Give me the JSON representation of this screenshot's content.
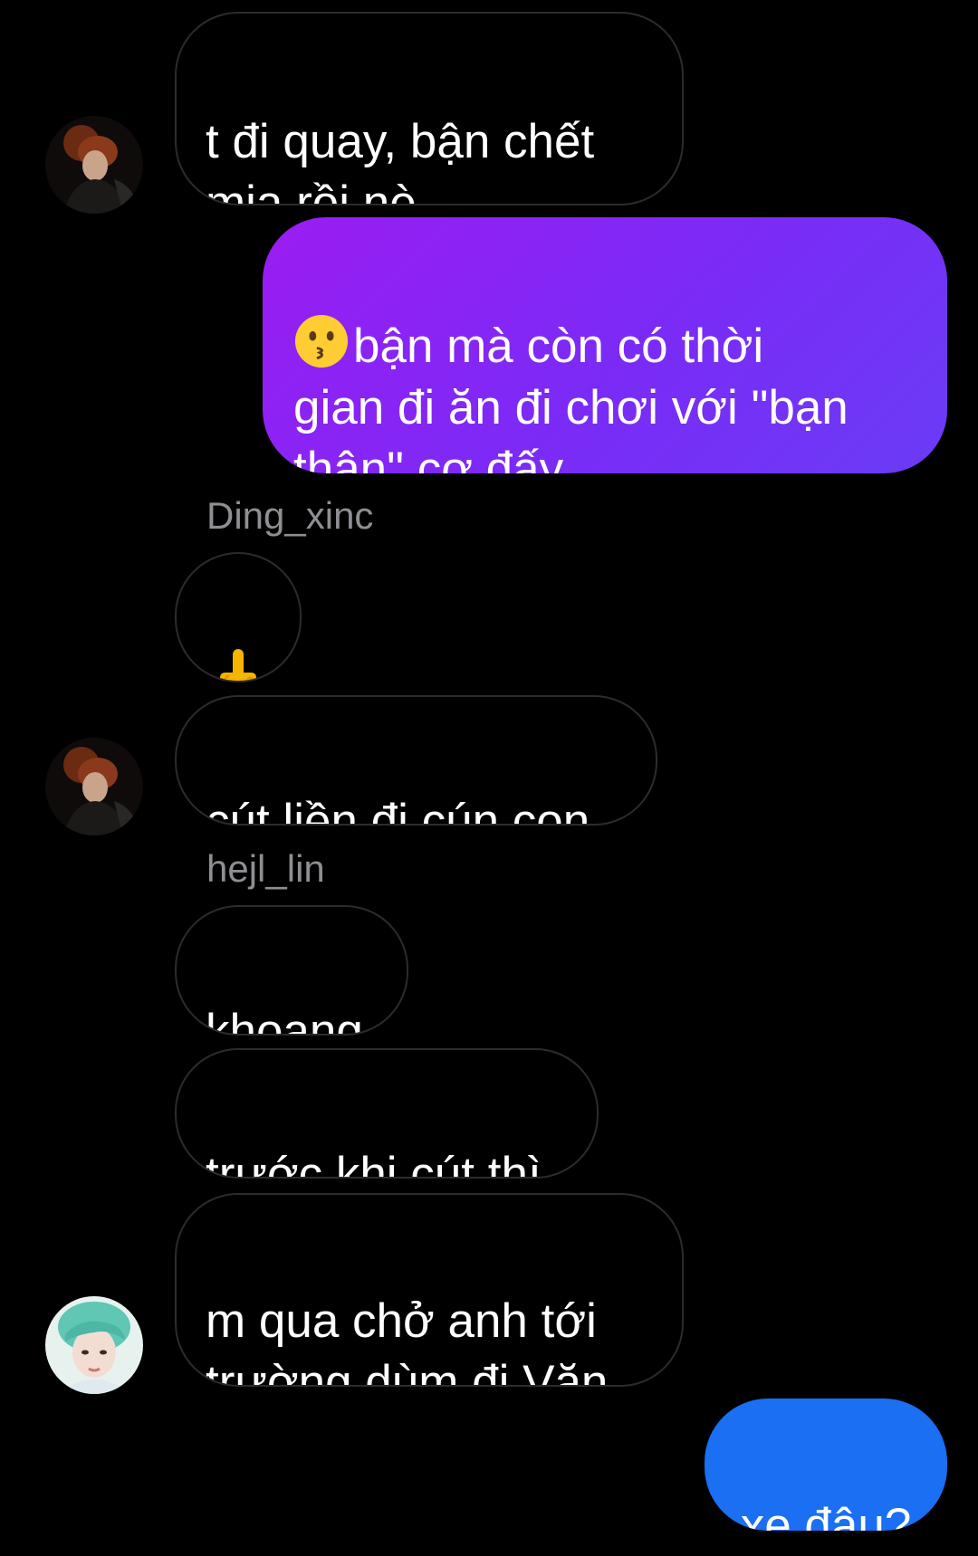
{
  "conversation": {
    "messages": [
      {
        "text": "t đi quay, bận chết\nmịa rồi nè"
      },
      {
        "emoji": "kissing-face-emoji",
        "text": "bận mà còn có thời\ngian đi ăn đi chơi với \"bạn\nthân\" cơ đấy"
      },
      {
        "sender": "Ding_xinc"
      },
      {
        "emoji": "middle-finger-emoji"
      },
      {
        "text": "cút liền đi cún con"
      },
      {
        "sender": "hejl_lin"
      },
      {
        "text": "khoang"
      },
      {
        "text": "trước khi cút thì"
      },
      {
        "text": "m qua chở anh tới\ntrường dùm đi Văn"
      },
      {
        "text": "xe đâu?"
      }
    ]
  },
  "colors": {
    "background": "#000000",
    "received_border": "#2c2c2e",
    "sent_purple_start": "#9b1cf2",
    "sent_purple_end": "#6a3cf6",
    "sent_blue": "#1a6ff2",
    "sender_name": "#8e8e93"
  }
}
